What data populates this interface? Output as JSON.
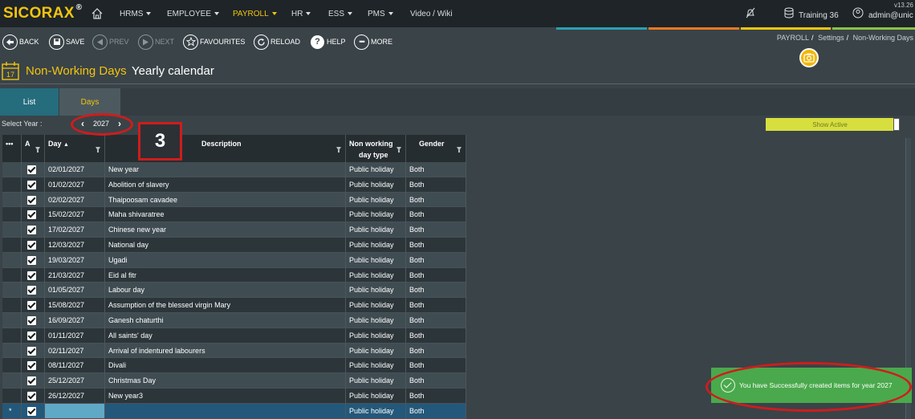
{
  "app": {
    "name": "SICORAX",
    "registered": "®",
    "version": "v13.26"
  },
  "nav": [
    {
      "label": "HRMS",
      "has_menu": true,
      "active": false
    },
    {
      "label": "EMPLOYEE",
      "has_menu": true,
      "active": false
    },
    {
      "label": "PAYROLL",
      "has_menu": true,
      "active": true
    },
    {
      "label": "HR",
      "has_menu": true,
      "active": false
    },
    {
      "label": "ESS",
      "has_menu": true,
      "active": false
    },
    {
      "label": "PMS",
      "has_menu": true,
      "active": false
    },
    {
      "label": "Video / Wiki",
      "has_menu": false,
      "active": false
    }
  ],
  "topright": {
    "notifications_icon": "bell-off-icon",
    "database_icon": "database-icon",
    "database_label": "Training 36",
    "user_icon": "user-icon",
    "user_label": "admin@unic"
  },
  "colors": {
    "brand": "#f2c40f",
    "colorbar": [
      "#2a9fb5",
      "#e67a22",
      "#f2c40f",
      "#8ac146"
    ],
    "toast": "#4aa94c",
    "annotation": "#d01c1c"
  },
  "toolbar": {
    "back": "BACK",
    "save": "SAVE",
    "prev": "PREV",
    "next": "NEXT",
    "favourites": "FAVOURITES",
    "reload": "RELOAD",
    "help": "HELP",
    "more": "MORE"
  },
  "breadcrumb": [
    "PAYROLL",
    "Settings",
    "Non-Working Days"
  ],
  "page": {
    "title": "Non-Working Days",
    "subtitle": "Yearly calendar"
  },
  "tabs": [
    "List",
    "Days"
  ],
  "year_selector": {
    "label": "Select Year :",
    "value": "2027"
  },
  "show_active_label": "Show Active",
  "annotation_number": "3",
  "grid": {
    "columns": [
      "•••",
      "A",
      "Day",
      "Description",
      "Non working day type",
      "Gender"
    ],
    "column_header_line1": "Non working",
    "column_header_line2": "day type",
    "rows": [
      {
        "active": true,
        "day": "02/01/2027",
        "description": "New year",
        "type": "Public holiday",
        "gender": "Both"
      },
      {
        "active": true,
        "day": "01/02/2027",
        "description": "Abolition of slavery",
        "type": "Public holiday",
        "gender": "Both"
      },
      {
        "active": true,
        "day": "02/02/2027",
        "description": "Thaipoosam cavadee",
        "type": "Public holiday",
        "gender": "Both"
      },
      {
        "active": true,
        "day": "15/02/2027",
        "description": "Maha shivaratree",
        "type": "Public holiday",
        "gender": "Both"
      },
      {
        "active": true,
        "day": "17/02/2027",
        "description": "Chinese new year",
        "type": "Public holiday",
        "gender": "Both"
      },
      {
        "active": true,
        "day": "12/03/2027",
        "description": "National day",
        "type": "Public holiday",
        "gender": "Both"
      },
      {
        "active": true,
        "day": "19/03/2027",
        "description": "Ugadi",
        "type": "Public holiday",
        "gender": "Both"
      },
      {
        "active": true,
        "day": "21/03/2027",
        "description": "Eid al fitr",
        "type": "Public holiday",
        "gender": "Both"
      },
      {
        "active": true,
        "day": "01/05/2027",
        "description": "Labour day",
        "type": "Public holiday",
        "gender": "Both"
      },
      {
        "active": true,
        "day": "15/08/2027",
        "description": "Assumption of the blessed virgin Mary",
        "type": "Public holiday",
        "gender": "Both"
      },
      {
        "active": true,
        "day": "16/09/2027",
        "description": "Ganesh chaturthi",
        "type": "Public holiday",
        "gender": "Both"
      },
      {
        "active": true,
        "day": "01/11/2027",
        "description": "All saints' day",
        "type": "Public holiday",
        "gender": "Both"
      },
      {
        "active": true,
        "day": "02/11/2027",
        "description": "Arrival of indentured labourers",
        "type": "Public holiday",
        "gender": "Both"
      },
      {
        "active": true,
        "day": "08/11/2027",
        "description": "Divali",
        "type": "Public holiday",
        "gender": "Both"
      },
      {
        "active": true,
        "day": "25/12/2027",
        "description": "Christmas Day",
        "type": "Public holiday",
        "gender": "Both"
      },
      {
        "active": true,
        "day": "26/12/2027",
        "description": "New year3",
        "type": "Public holiday",
        "gender": "Both"
      }
    ],
    "new_row": {
      "marker": "*",
      "active": true,
      "day": "",
      "description": "",
      "type": "Public holiday",
      "gender": "Both"
    }
  },
  "toast": {
    "message": "You have Successfully created items for year 2027"
  }
}
